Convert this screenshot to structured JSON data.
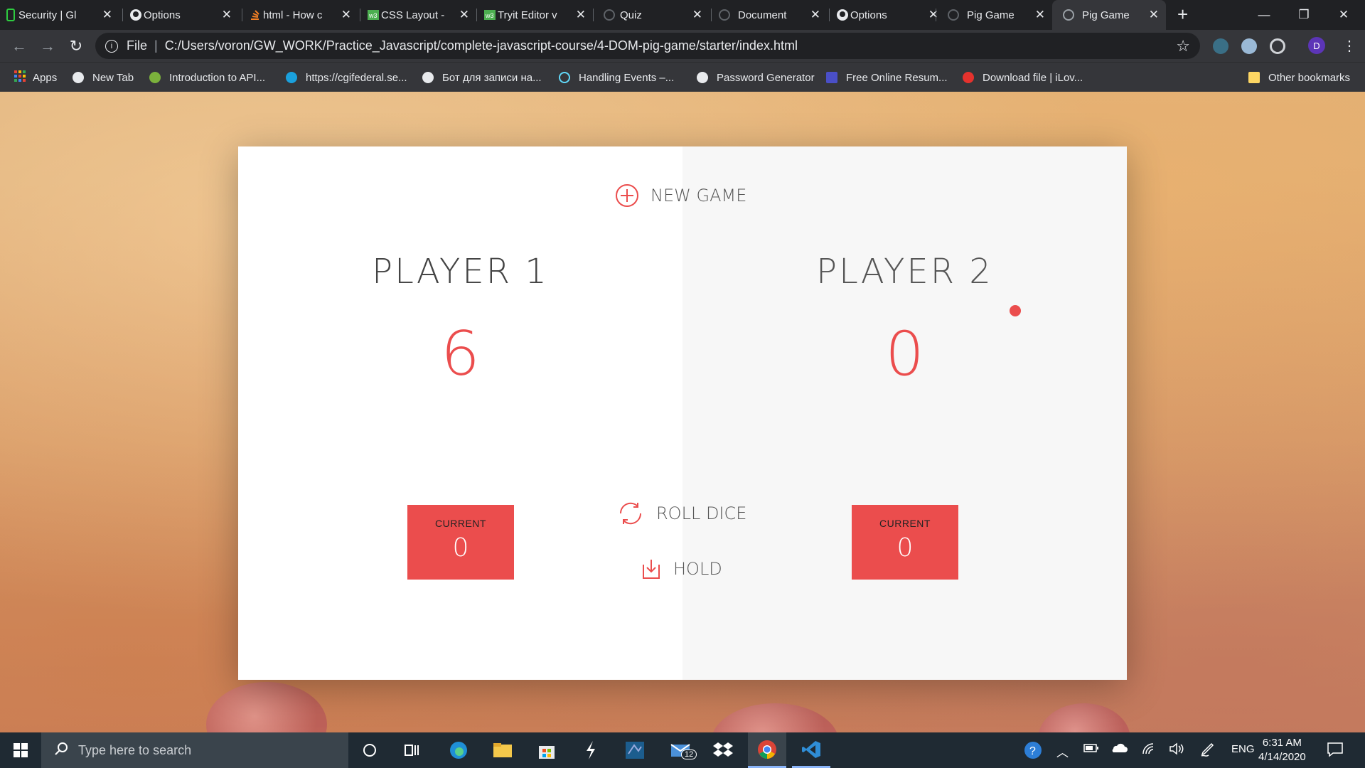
{
  "browser": {
    "tabs": [
      {
        "title": "Security | Gl",
        "icon": "security-icon",
        "active": false
      },
      {
        "title": "Options",
        "icon": "github-icon",
        "active": false
      },
      {
        "title": "html - How c",
        "icon": "stackoverflow-icon",
        "active": false
      },
      {
        "title": "CSS Layout -",
        "icon": "w3schools-icon",
        "active": false
      },
      {
        "title": "Tryit Editor v",
        "icon": "w3schools-icon",
        "active": false
      },
      {
        "title": "Quiz",
        "icon": "globe-icon",
        "active": false
      },
      {
        "title": "Document",
        "icon": "globe-icon",
        "active": false
      },
      {
        "title": "Options",
        "icon": "github-icon",
        "active": false
      },
      {
        "title": "Pig Game",
        "icon": "globe-icon",
        "active": false
      },
      {
        "title": "Pig Game",
        "icon": "globe-icon",
        "active": true
      }
    ],
    "address": {
      "scheme_label": "File",
      "url": "C:/Users/voron/GW_WORK/Practice_Javascript/complete-javascript-course/4-DOM-pig-game/starter/index.html"
    },
    "profile_initial": "D",
    "bookmarks": [
      {
        "label": "Apps"
      },
      {
        "label": "New Tab"
      },
      {
        "label": "Introduction to API..."
      },
      {
        "label": "https://cgifederal.se..."
      },
      {
        "label": "Бот для записи на..."
      },
      {
        "label": "Handling Events –..."
      },
      {
        "label": "Password Generator"
      },
      {
        "label": "Free Online Resum..."
      },
      {
        "label": "Download file | iLov..."
      },
      {
        "label": "Other bookmarks"
      }
    ]
  },
  "game": {
    "new_game_label": "NEW GAME",
    "roll_dice_label": "ROLL DICE",
    "hold_label": "HOLD",
    "players": [
      {
        "name": "PLAYER 1",
        "score": "6",
        "current_label": "Current",
        "current_value": "0",
        "active": false
      },
      {
        "name": "PLAYER 2",
        "score": "0",
        "current_label": "Current",
        "current_value": "0",
        "active": true
      }
    ],
    "accent_color": "#eb4d4d"
  },
  "taskbar": {
    "search_placeholder": "Type here to search",
    "mail_badge": "12",
    "language": "ENG",
    "time": "6:31 AM",
    "date": "4/14/2020"
  }
}
